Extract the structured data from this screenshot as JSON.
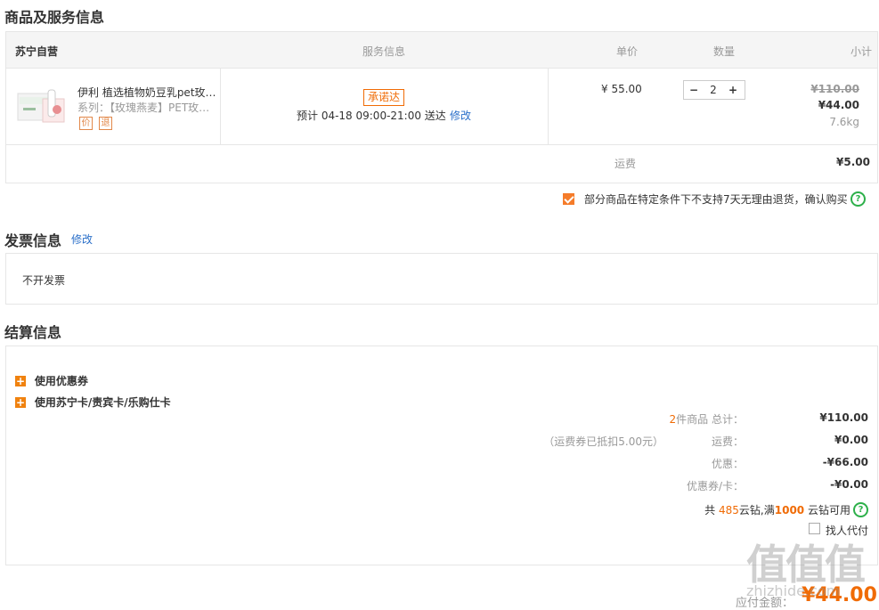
{
  "sections": {
    "products_title": "商品及服务信息",
    "invoice_title": "发票信息",
    "invoice_edit": "修改",
    "settle_title": "结算信息"
  },
  "table": {
    "store": "苏宁自营",
    "col_service": "服务信息",
    "col_price": "单价",
    "col_qty": "数量",
    "col_subtotal": "小计"
  },
  "item": {
    "name": "伊利 植选植物奶豆乳pet玫…",
    "series": "系列：【玫瑰燕麦】PET玫…",
    "tag_price": "价",
    "tag_return": "退",
    "promise_badge": "承诺达",
    "delivery_prefix": "预计  04-18  09:00-21:00  送达",
    "delivery_edit": "修改",
    "unit_price": "¥  55.00",
    "qty_minus": "−",
    "qty": "2",
    "qty_plus": "+",
    "orig_total": "¥110.00",
    "total": "¥44.00",
    "weight": "7.6kg"
  },
  "shipping": {
    "label": "运费",
    "value": "¥5.00"
  },
  "notice": {
    "text": "部分商品在特定条件下不支持7天无理由退货，确认购买",
    "checked": true
  },
  "invoice": {
    "value": "不开发票"
  },
  "settle": {
    "coupon_label": "使用优惠券",
    "card_label": "使用苏宁卡/责宾卡/乐购仕卡",
    "count_num": "2",
    "count_text": "件商品  总计：",
    "total_value": "¥110.00",
    "freight_note": "（运费券已抵扣5.00元）",
    "freight_label": "运费：",
    "freight_value": "¥0.00",
    "discount_label": "优惠：",
    "discount_value": "-¥66.00",
    "coupon_card_label": "优惠券/卡：",
    "coupon_card_value": "-¥0.00",
    "yunzuan_pre": "共",
    "yunzuan_num": "485",
    "yunzuan_mid": "云钻,满",
    "yunzuan_min": "1000",
    "yunzuan_post": "云钻可用",
    "proxy_pay": "找人代付",
    "payable_label": "应付金额：",
    "payable_value": "¥44.00"
  },
  "watermark": {
    "big": "值值值",
    "small": "zhizhide.com"
  },
  "colors": {
    "accent": "#f06b05",
    "link": "#2a6fc9",
    "help": "#2db04a"
  }
}
